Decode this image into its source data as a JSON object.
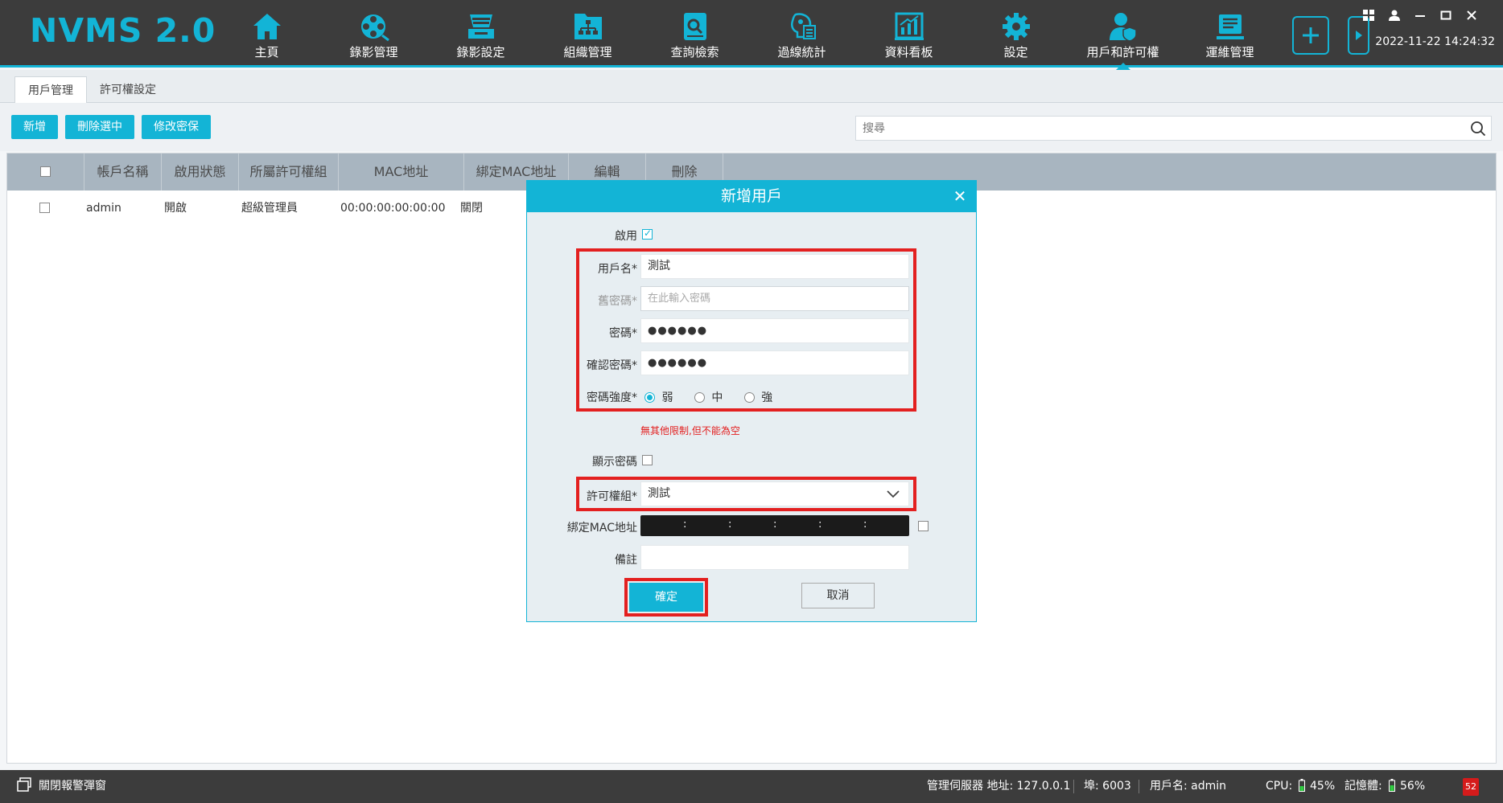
{
  "app": {
    "logo": "NVMS 2.0",
    "datetime": "2022-11-22 14:24:32"
  },
  "nav": [
    {
      "label": "主頁",
      "icon": "home-icon"
    },
    {
      "label": "錄影管理",
      "icon": "film-reel-icon"
    },
    {
      "label": "錄影設定",
      "icon": "record-settings-icon"
    },
    {
      "label": "組織管理",
      "icon": "org-chart-icon"
    },
    {
      "label": "查詢檢索",
      "icon": "search-document-icon"
    },
    {
      "label": "過線統計",
      "icon": "line-crossing-icon"
    },
    {
      "label": "資料看板",
      "icon": "dashboard-chart-icon"
    },
    {
      "label": "設定",
      "icon": "gear-icon"
    },
    {
      "label": "用戶和許可權",
      "icon": "user-shield-icon"
    },
    {
      "label": "運維管理",
      "icon": "maintenance-icon"
    }
  ],
  "tabs": {
    "user_mgmt": "用戶管理",
    "perm_settings": "許可權設定"
  },
  "toolbar": {
    "add": "新增",
    "delete_selected": "刪除選中",
    "modify_security": "修改密保"
  },
  "search": {
    "placeholder": "搜尋"
  },
  "table": {
    "headers": {
      "account": "帳戶名稱",
      "status": "啟用狀態",
      "group": "所屬許可權組",
      "mac": "MAC地址",
      "bind_mac": "綁定MAC地址",
      "edit": "編輯",
      "delete": "刪除"
    },
    "rows": [
      {
        "account": "admin",
        "status": "開啟",
        "group": "超級管理員",
        "mac": "00:00:00:00:00:00",
        "bind_mac": "關閉"
      }
    ]
  },
  "dialog": {
    "title": "新增用戶",
    "enable_label": "啟用",
    "username_label": "用戶名*",
    "username_value": "測試",
    "old_pwd_label": "舊密碼*",
    "old_pwd_placeholder": "在此輸入密碼",
    "pwd_label": "密碼*",
    "pwd_value": "●●●●●●",
    "confirm_pwd_label": "確認密碼*",
    "confirm_pwd_value": "●●●●●●",
    "strength_label": "密碼強度*",
    "strength_weak": "弱",
    "strength_medium": "中",
    "strength_strong": "強",
    "hint": "無其他限制,但不能為空",
    "show_pwd_label": "顯示密碼",
    "perm_group_label": "許可權組*",
    "perm_group_value": "測試",
    "bind_mac_label": "綁定MAC地址",
    "mac_separator": ":",
    "remark_label": "備註",
    "ok": "確定",
    "cancel": "取消"
  },
  "statusbar": {
    "close_alarm": "關閉報警彈窗",
    "server_addr": "管理伺服器 地址: 127.0.0.1",
    "port": "埠: 6003",
    "username": "用戶名: admin",
    "cpu_label": "CPU:",
    "cpu_value": "45%",
    "mem_label": "記憶體:",
    "mem_value": "56%",
    "badge": "52"
  },
  "colors": {
    "accent": "#13b4d6",
    "topbar": "#3c3c3c",
    "highlight": "#e32020"
  }
}
